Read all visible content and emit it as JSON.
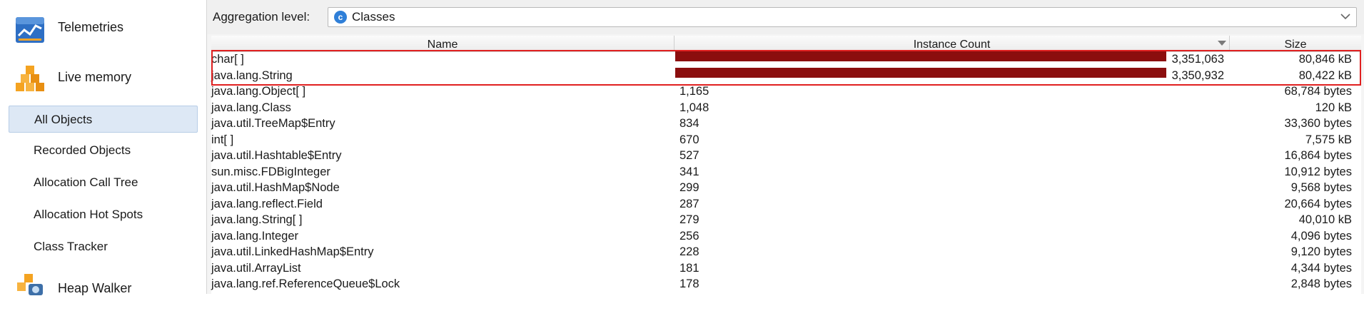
{
  "sidebar": {
    "telemetries_label": "Telemetries",
    "live_memory_label": "Live memory",
    "heap_walker_label": "Heap Walker",
    "items": [
      {
        "label": "All Objects",
        "selected": true
      },
      {
        "label": "Recorded Objects"
      },
      {
        "label": "Allocation Call Tree"
      },
      {
        "label": "Allocation Hot Spots"
      },
      {
        "label": "Class Tracker"
      }
    ],
    "icons": {
      "telemetries": "telemetry-chart-icon",
      "live_memory": "memory-blocks-icon",
      "heap_walker": "heap-walker-icon"
    }
  },
  "aggregation": {
    "label": "Aggregation level:",
    "value": "Classes",
    "icon": "class-c-icon",
    "icon_glyph": "c"
  },
  "table": {
    "columns": {
      "name": "Name",
      "count": "Instance Count",
      "size": "Size"
    },
    "sort_column": "Instance Count",
    "bar_color": "#8b0e0e",
    "highlight_color": "#e02020",
    "rows": [
      {
        "name": "char[ ]",
        "count": "3,351,063",
        "size": "80,846 kB",
        "bar_fraction": 1.0
      },
      {
        "name": "java.lang.String",
        "count": "3,350,932",
        "size": "80,422 kB",
        "bar_fraction": 0.99996
      },
      {
        "name": "java.lang.Object[ ]",
        "count": "1,165",
        "size": "68,784 bytes"
      },
      {
        "name": "java.lang.Class",
        "count": "1,048",
        "size": "120 kB"
      },
      {
        "name": "java.util.TreeMap$Entry",
        "count": "834",
        "size": "33,360 bytes"
      },
      {
        "name": "int[ ]",
        "count": "670",
        "size": "7,575 kB"
      },
      {
        "name": "java.util.Hashtable$Entry",
        "count": "527",
        "size": "16,864 bytes"
      },
      {
        "name": "sun.misc.FDBigInteger",
        "count": "341",
        "size": "10,912 bytes"
      },
      {
        "name": "java.util.HashMap$Node",
        "count": "299",
        "size": "9,568 bytes"
      },
      {
        "name": "java.lang.reflect.Field",
        "count": "287",
        "size": "20,664 bytes"
      },
      {
        "name": "java.lang.String[ ]",
        "count": "279",
        "size": "40,010 kB"
      },
      {
        "name": "java.lang.Integer",
        "count": "256",
        "size": "4,096 bytes"
      },
      {
        "name": "java.util.LinkedHashMap$Entry",
        "count": "228",
        "size": "9,120 bytes"
      },
      {
        "name": "java.util.ArrayList",
        "count": "181",
        "size": "4,344 bytes"
      },
      {
        "name": "java.lang.ref.ReferenceQueue$Lock",
        "count": "178",
        "size": "2,848 bytes"
      }
    ]
  }
}
